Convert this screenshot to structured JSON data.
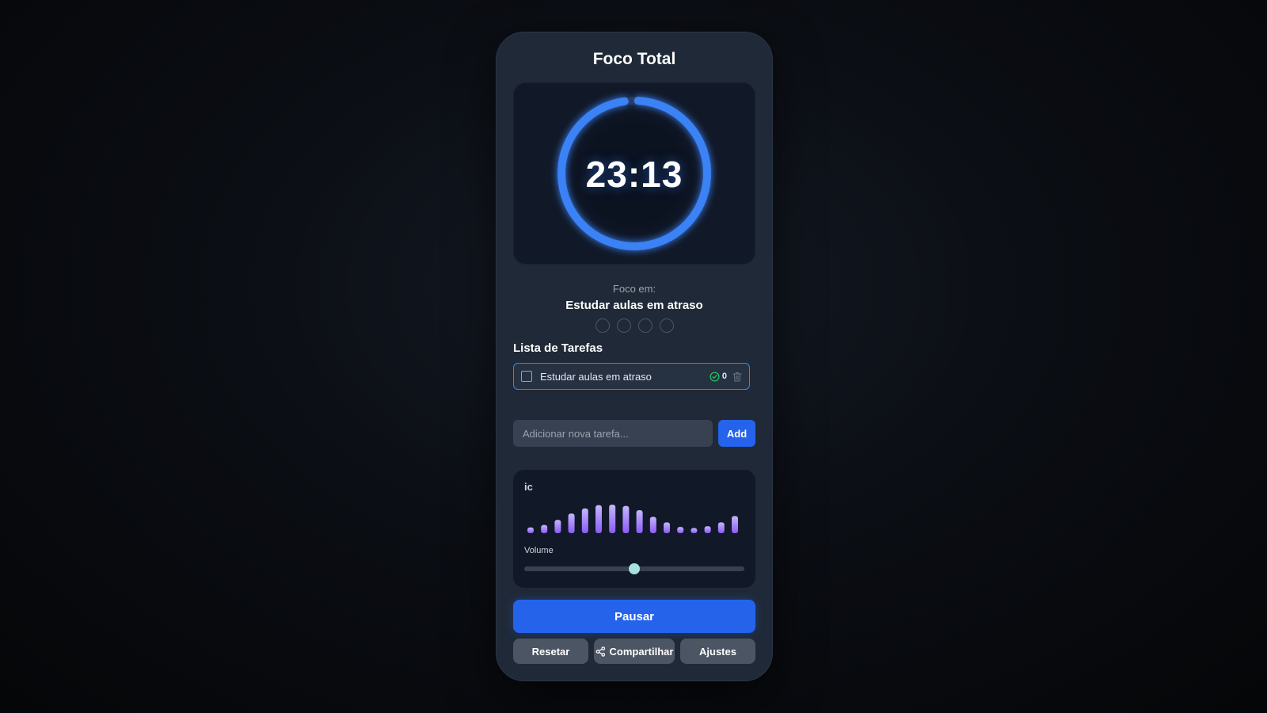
{
  "app": {
    "title": "Foco Total"
  },
  "timer": {
    "display": "23:13",
    "progress_fraction": 0.97,
    "ring_color": "#3b82f6"
  },
  "focus": {
    "label": "Foco em:",
    "task": "Estudar aulas em atraso",
    "session_dots": [
      false,
      false,
      false,
      false
    ]
  },
  "task_list": {
    "title": "Lista de Tarefas",
    "items": [
      {
        "text": "Estudar aulas em atraso",
        "checked": false,
        "count": "0",
        "count_icon": "check-circle-icon",
        "delete_icon": "trash-icon"
      }
    ]
  },
  "add_task": {
    "placeholder": "Adicionar nova tarefa...",
    "button_label": "Add"
  },
  "sound": {
    "label": "ic",
    "equalizer_levels": [
      0.1,
      0.2,
      0.4,
      0.65,
      0.85,
      0.98,
      1.0,
      0.95,
      0.78,
      0.52,
      0.3,
      0.12,
      0.08,
      0.15,
      0.3,
      0.55
    ],
    "volume_label": "Volume",
    "volume": 0.5,
    "bar_color_top": "#c4b5fd",
    "bar_color_bottom": "#8b5cf6"
  },
  "controls": {
    "primary_label": "Pausar",
    "reset_label": "Resetar",
    "share_label": "Compartilhar",
    "share_icon": "share-icon",
    "settings_label": "Ajustes"
  }
}
